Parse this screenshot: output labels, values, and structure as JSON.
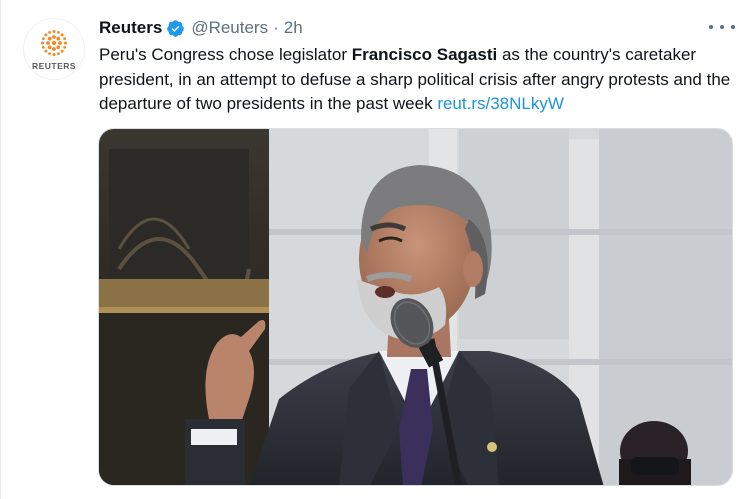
{
  "tweet": {
    "author_name": "Reuters",
    "handle": "@Reuters",
    "separator": "·",
    "time": "2h",
    "avatar_brand": "REUTERS",
    "text_part1": "Peru's Congress chose legislator ",
    "text_bold": "Francisco Sagasti",
    "text_part2": " as the country's caretaker president, in an attempt to defuse a sharp political crisis after angry protests and the departure of two presidents in the past week ",
    "link": "reut.rs/38NLkyW",
    "more_icon": "more-options-icon",
    "verified_icon": "verified-badge-icon"
  },
  "colors": {
    "link": "#1b95e0",
    "verified": "#1d9bf0",
    "secondary_text": "#5b7083",
    "brand_orange": "#f08a24"
  }
}
